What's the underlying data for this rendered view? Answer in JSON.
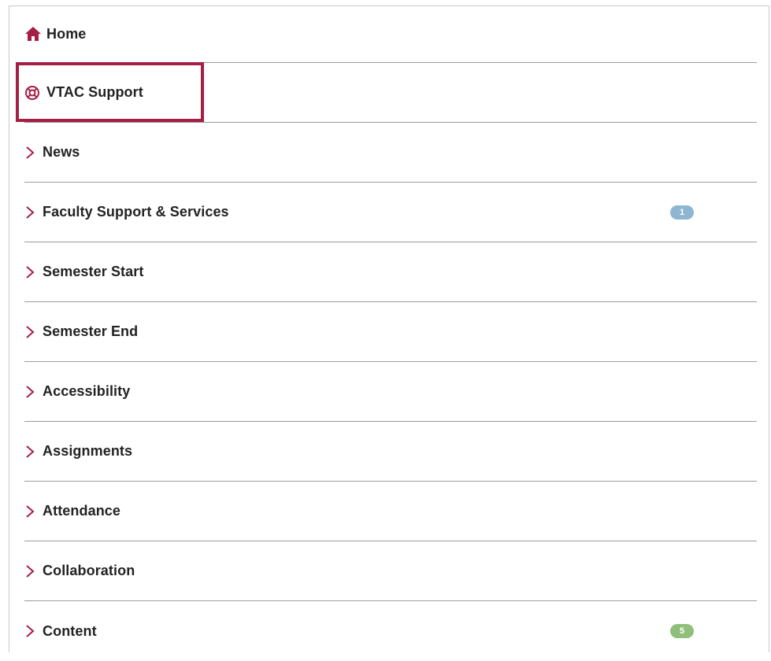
{
  "colors": {
    "accent": "#a51e44",
    "badge_blue": "#8fb6d1",
    "badge_green": "#8fbf7a",
    "divider": "#9c9c9c",
    "text": "#222222"
  },
  "menu": {
    "home": {
      "label": "Home",
      "icon": "home-icon"
    },
    "support": {
      "label": "VTAC Support",
      "icon": "lifebuoy-icon",
      "highlighted": true
    },
    "items": [
      {
        "label": "News",
        "icon": "chevron-right-icon",
        "badge": ""
      },
      {
        "label": "Faculty Support & Services",
        "icon": "chevron-right-icon",
        "badge": "1",
        "badge_color": "#8fb6d1"
      },
      {
        "label": "Semester Start",
        "icon": "chevron-right-icon",
        "badge": ""
      },
      {
        "label": "Semester End",
        "icon": "chevron-right-icon",
        "badge": ""
      },
      {
        "label": "Accessibility",
        "icon": "chevron-right-icon",
        "badge": ""
      },
      {
        "label": "Assignments",
        "icon": "chevron-right-icon",
        "badge": ""
      },
      {
        "label": "Attendance",
        "icon": "chevron-right-icon",
        "badge": ""
      },
      {
        "label": "Collaboration",
        "icon": "chevron-right-icon",
        "badge": ""
      },
      {
        "label": "Content",
        "icon": "chevron-right-icon",
        "badge": "5",
        "badge_color": "#8fbf7a"
      }
    ]
  }
}
